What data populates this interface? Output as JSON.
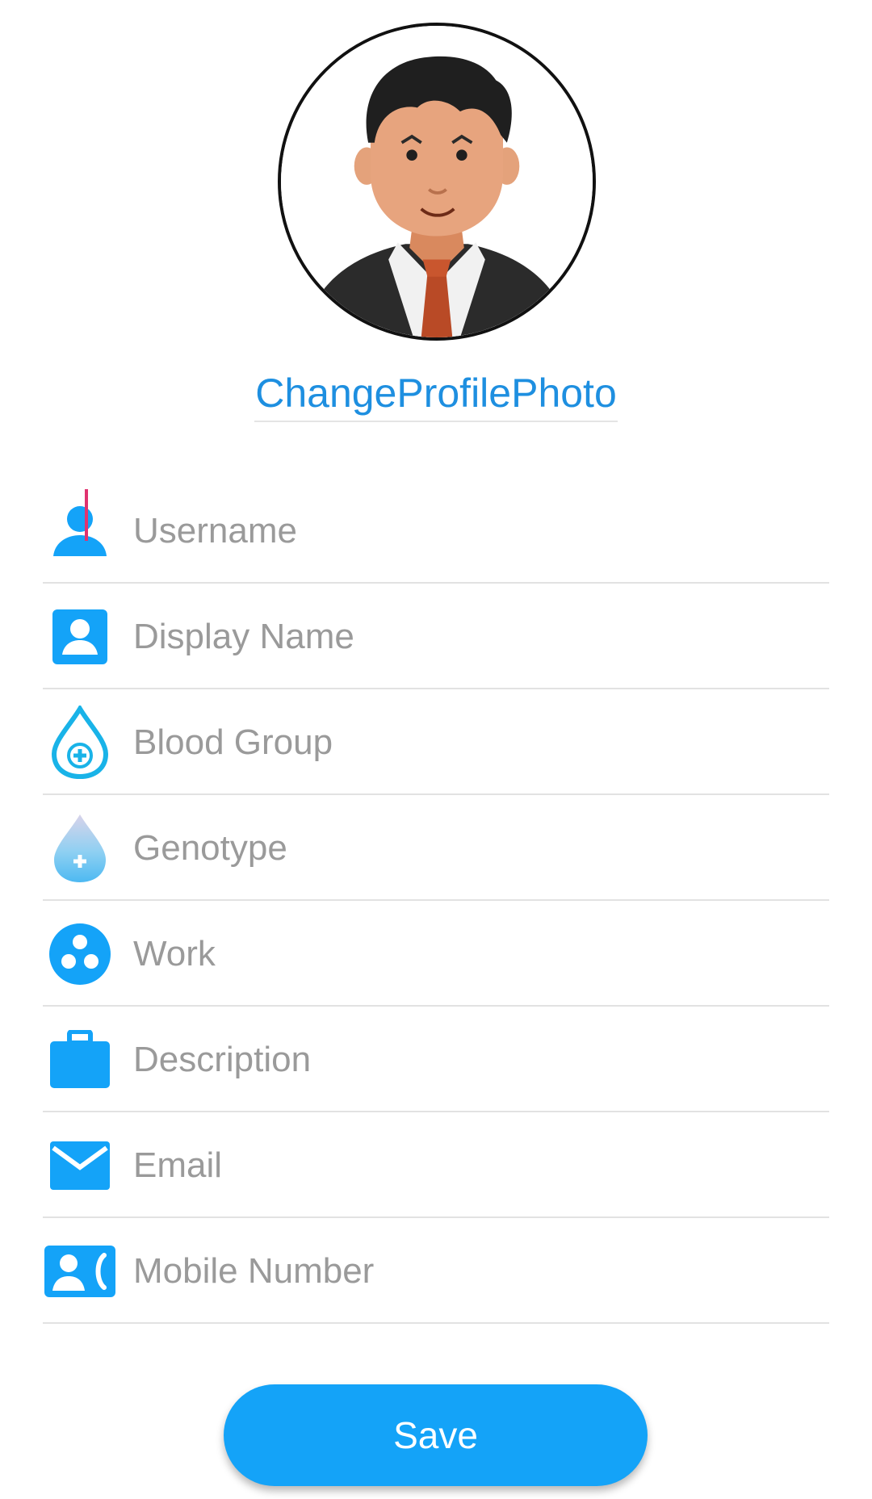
{
  "profile": {
    "change_photo_label": "ChangeProfilePhoto"
  },
  "fields": {
    "username": {
      "placeholder": "Username",
      "value": "",
      "icon": "person-icon"
    },
    "display_name": {
      "placeholder": "Display Name",
      "value": "",
      "icon": "contact-badge-icon"
    },
    "blood_group": {
      "placeholder": "Blood Group",
      "value": "",
      "icon": "blood-drop-outline-icon"
    },
    "genotype": {
      "placeholder": "Genotype",
      "value": "",
      "icon": "blood-drop-filled-icon"
    },
    "work": {
      "placeholder": "Work",
      "value": "",
      "icon": "work-circles-icon"
    },
    "description": {
      "placeholder": "Description",
      "value": "",
      "icon": "briefcase-icon"
    },
    "email": {
      "placeholder": "Email",
      "value": "",
      "icon": "mail-icon"
    },
    "mobile_number": {
      "placeholder": "Mobile Number",
      "value": "",
      "icon": "contact-phone-icon"
    }
  },
  "actions": {
    "save_label": "Save"
  },
  "colors": {
    "accent": "#14a3f8",
    "link": "#1e8fe0",
    "cursor": "#e0336f",
    "divider": "#e2e2e2",
    "placeholder": "#9a9a9a"
  }
}
